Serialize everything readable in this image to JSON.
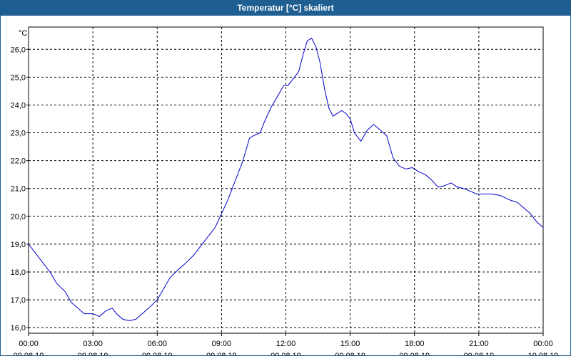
{
  "window": {
    "title": "Temperatur [°C] skaliert"
  },
  "colors": {
    "titlebar": "#1e5e91",
    "line": "#0000cc",
    "grid": "#000000"
  },
  "chart_data": {
    "type": "line",
    "title": "Temperatur [°C] skaliert",
    "ylabel": "°C",
    "xlabel": "",
    "ylim": [
      15.8,
      26.8
    ],
    "y_ticks": [
      "16,0",
      "17,0",
      "18,0",
      "19,0",
      "20,0",
      "21,0",
      "22,0",
      "23,0",
      "24,0",
      "25,0",
      "26,0"
    ],
    "y_tick_values": [
      16,
      17,
      18,
      19,
      20,
      21,
      22,
      23,
      24,
      25,
      26
    ],
    "x_tick_times": [
      "00:00",
      "03:00",
      "06:00",
      "09:00",
      "12:00",
      "15:00",
      "18:00",
      "21:00",
      "00:00"
    ],
    "x_tick_dates": [
      "09.08.19",
      "09.08.19",
      "09.08.19",
      "09.08.19",
      "09.08.19",
      "09.08.19",
      "09.08.19",
      "09.08.19",
      "10.08.19"
    ],
    "x_tick_hours": [
      0,
      3,
      6,
      9,
      12,
      15,
      18,
      21,
      24
    ],
    "xlim": [
      0,
      24
    ],
    "grid": "dashed",
    "series": [
      {
        "x": [
          0,
          0.3,
          0.6,
          1.0,
          1.3,
          1.7,
          2.0,
          2.3,
          2.6,
          3.0,
          3.3,
          3.6,
          3.9,
          4.1,
          4.4,
          4.7,
          5.0,
          5.3,
          5.6,
          6.0,
          6.3,
          6.6,
          7.0,
          7.3,
          7.7,
          8.0,
          8.3,
          8.7,
          9.0,
          9.3,
          9.6,
          10.0,
          10.3,
          10.5,
          10.8,
          11.0,
          11.3,
          11.6,
          11.9,
          12.1,
          12.3,
          12.6,
          12.8,
          13.0,
          13.2,
          13.4,
          13.6,
          13.8,
          14.0,
          14.2,
          14.4,
          14.6,
          14.8,
          15.0,
          15.2,
          15.5,
          15.8,
          16.1,
          16.4,
          16.7,
          17.0,
          17.3,
          17.6,
          17.9,
          18.2,
          18.5,
          18.8,
          19.1,
          19.4,
          19.7,
          20.0,
          20.3,
          20.6,
          20.9,
          21.2,
          21.6,
          22.0,
          22.4,
          22.8,
          23.1,
          23.4,
          23.7,
          24.0
        ],
        "y": [
          19.0,
          18.7,
          18.4,
          18.0,
          17.6,
          17.3,
          16.9,
          16.7,
          16.5,
          16.5,
          16.4,
          16.6,
          16.7,
          16.5,
          16.3,
          16.25,
          16.3,
          16.5,
          16.7,
          17.0,
          17.4,
          17.8,
          18.1,
          18.3,
          18.6,
          18.9,
          19.2,
          19.6,
          20.1,
          20.6,
          21.2,
          22.0,
          22.8,
          22.9,
          23.0,
          23.4,
          23.9,
          24.3,
          24.7,
          24.7,
          24.9,
          25.2,
          25.8,
          26.3,
          26.4,
          26.1,
          25.5,
          24.6,
          23.9,
          23.6,
          23.7,
          23.8,
          23.7,
          23.5,
          23.0,
          22.7,
          23.1,
          23.3,
          23.1,
          22.9,
          22.1,
          21.8,
          21.7,
          21.75,
          21.6,
          21.5,
          21.3,
          21.05,
          21.1,
          21.2,
          21.05,
          21.0,
          20.9,
          20.8,
          20.8,
          20.8,
          20.75,
          20.6,
          20.5,
          20.3,
          20.1,
          19.8,
          19.6
        ]
      }
    ]
  }
}
